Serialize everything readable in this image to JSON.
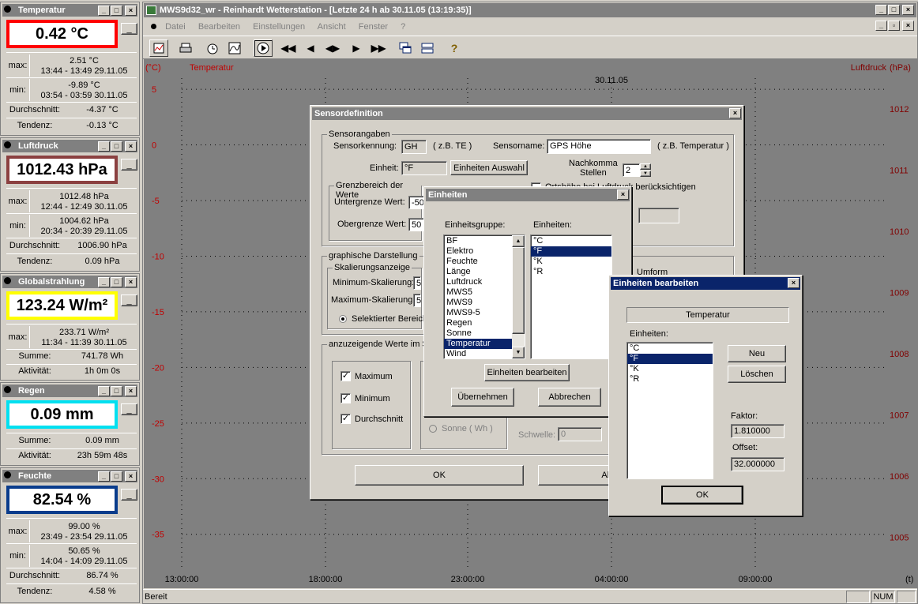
{
  "panels": {
    "temp": {
      "title": "Temperatur",
      "value": "0.42 °C",
      "max_val": "2.51 °C",
      "max_time": "13:44 - 13:49  29.11.05",
      "min_val": "-9.89 °C",
      "min_time": "03:54 - 03:59  30.11.05",
      "avg_label": "Durchschnitt:",
      "avg": "-4.37 °C",
      "trend_label": "Tendenz:",
      "trend": "-0.13 °C",
      "max_label": "max:",
      "min_label": "min:",
      "color": "#ff0000"
    },
    "druck": {
      "title": "Luftdruck",
      "value": "1012.43 hPa",
      "max_val": "1012.48 hPa",
      "max_time": "12:44 - 12:49  30.11.05",
      "min_val": "1004.62 hPa",
      "min_time": "20:34 - 20:39  29.11.05",
      "avg_label": "Durchschnitt:",
      "avg": "1006.90 hPa",
      "trend_label": "Tendenz:",
      "trend": "0.09 hPa",
      "max_label": "max:",
      "min_label": "min:",
      "color": "#8b4040"
    },
    "global": {
      "title": "Globalstrahlung",
      "value": "123.24 W/m²",
      "max_val": "233.71 W/m²",
      "max_time": "11:34 - 11:39  30.11.05",
      "sum_label": "Summe:",
      "sum": "741.78 Wh",
      "act_label": "Aktivität:",
      "act": "1h 0m 0s",
      "max_label": "max:",
      "color": "#ffff00"
    },
    "regen": {
      "title": "Regen",
      "value": "0.09 mm",
      "sum_label": "Summe:",
      "sum": "0.09 mm",
      "act_label": "Aktivität:",
      "act": "23h 59m 48s",
      "color": "#00e0f0"
    },
    "feuchte": {
      "title": "Feuchte",
      "value": "82.54 %",
      "max_val": "99.00 %",
      "max_time": "23:49 - 23:54  29.11.05",
      "min_val": "50.65 %",
      "min_time": "14:04 - 14:09  29.11.05",
      "avg_label": "Durchschnitt:",
      "avg": "86.74 %",
      "trend_label": "Tendenz:",
      "trend": "4.58 %",
      "max_label": "max:",
      "min_label": "min:",
      "color": "#0a3c8c"
    }
  },
  "window": {
    "title": "MWS9d32_wr - Reinhardt Wetterstation - [Letzte 24 h ab 30.11.05 (13:19:35)]"
  },
  "menu": [
    "Datei",
    "Bearbeiten",
    "Einstellungen",
    "Ansicht",
    "Fenster",
    "?"
  ],
  "chart_data": {
    "type": "line",
    "title": "30.11.05",
    "left_axis_unit": "(°C)",
    "left_axis_label": "Temperatur",
    "right_axis_unit": "(hPa)",
    "right_axis_label": "Luftdruck",
    "x_unit": "(t)",
    "x_ticks": [
      "13:00:00",
      "18:00:00",
      "23:00:00",
      "04:00:00",
      "09:00:00"
    ],
    "y_left_ticks": [
      "5",
      "0",
      "-5",
      "-10",
      "-15",
      "-20",
      "-25",
      "-30",
      "-35"
    ],
    "y_right_ticks": [
      "1012",
      "1011",
      "1010",
      "1009",
      "1008",
      "1007",
      "1006",
      "1005"
    ],
    "ylim_left": [
      -38,
      6
    ],
    "ylim_right": [
      1004.5,
      1012.5
    ],
    "series": []
  },
  "status": {
    "text": "Bereit",
    "num": "NUM"
  },
  "sensordef": {
    "title": "Sensordefinition",
    "grp_sensor": "Sensorangaben",
    "kennung_label": "Sensorkennung:",
    "kennung": "GH",
    "kennung_hint": "( z.B. TE )",
    "name_label": "Sensorname:",
    "name": "GPS Höhe",
    "name_hint": "( z.B. Temperatur )",
    "einheit_label": "Einheit:",
    "einheit": "°F",
    "einheit_btn": "Einheiten Auswahl",
    "nachkomma_label": "Nachkomma\nStellen",
    "nachkomma": "2",
    "grenz_label": "Grenzbereich der Werte",
    "unter_label": "Untergrenze Wert:",
    "unter": "-50",
    "ober_label": "Obergrenze Wert:",
    "ober": "50",
    "check_label": "Ortshöhe bei Luftdruck berücksichtigen",
    "grafik_label": "graphische Darstellung",
    "skal_label": "Skalierungsanzeige",
    "minskal_label": "Minimum-Skalierung:",
    "minskal": "5",
    "maxskal_label": "Maximum-Skalierung:",
    "maxskal": "5",
    "selbereich_label": "Selektierter Bereich",
    "umform_label": "Umform",
    "anzeige_label": "anzuzeigende Werte im Sensorfenster",
    "maximum": "Maximum",
    "minimum": "Minimum",
    "durchschnitt": "Durchschnitt",
    "sonne": "Sonne ( Wh )",
    "schwelle_label": "Schwelle:",
    "schwelle": "0",
    "ok": "OK",
    "abbrechen": "Abbrechen"
  },
  "einheiten": {
    "title": "Einheiten",
    "gruppe_label": "Einheitsgruppe:",
    "einheiten_label": "Einheiten:",
    "gruppen": [
      "BF",
      "Elektro",
      "Feuchte",
      "Länge",
      "Luftdruck",
      "MWS5",
      "MWS9",
      "MWS9-5",
      "Regen",
      "Sonne",
      "Temperatur",
      "Wind"
    ],
    "gruppe_selected": 10,
    "units": [
      "°C",
      "°F",
      "°K",
      "°R"
    ],
    "unit_selected": 1,
    "bearbeiten_btn": "Einheiten bearbeiten",
    "uebernehmen_btn": "Übernehmen",
    "abbrechen_btn": "Abbrechen"
  },
  "bearbeiten": {
    "title": "Einheiten bearbeiten",
    "gruppe": "Temperatur",
    "einheiten_label": "Einheiten:",
    "units": [
      "°C",
      "°F",
      "°K",
      "°R"
    ],
    "unit_selected": 1,
    "neu": "Neu",
    "loeschen": "Löschen",
    "faktor_label": "Faktor:",
    "faktor": "1.810000",
    "offset_label": "Offset:",
    "offset": "32.000000",
    "ok": "OK"
  }
}
